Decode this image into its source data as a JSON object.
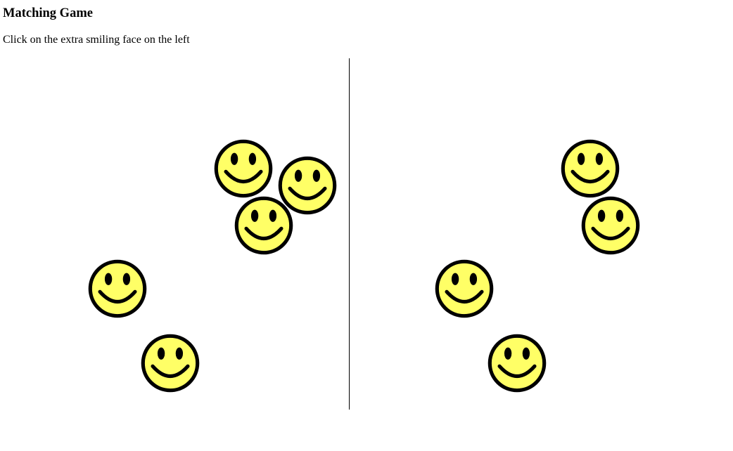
{
  "page": {
    "title": "Matching Game",
    "instruction": "Click on the extra smiling face on the left"
  },
  "game": {
    "icon": "smiling-face-icon",
    "colors": {
      "face_fill": "#FFFF66",
      "face_outline": "#000000",
      "divider": "#000000"
    },
    "left_face_count": 5,
    "right_face_count": 4
  }
}
